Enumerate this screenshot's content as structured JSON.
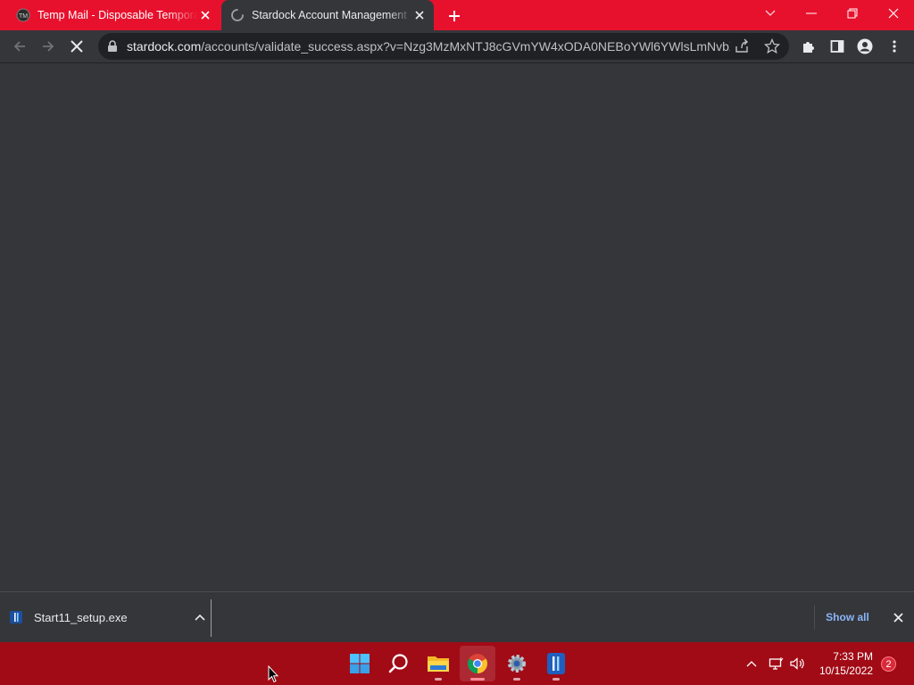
{
  "browser": {
    "tabs": [
      {
        "title": "Temp Mail - Disposable Temporary Email",
        "icon": "tempmail-favicon",
        "active": false
      },
      {
        "title": "Stardock Account Management - Validate",
        "icon": "loading-spinner-icon",
        "active": true
      }
    ],
    "url_host": "stardock.com",
    "url_path": "/accounts/validate_success.aspx?v=Nzg3MzMxNTJ8cGVmYW4xODA0NEBoYWl6YWlsLmNvbX...",
    "colors": {
      "accent": "#e8112d",
      "page_bg": "#35363a",
      "link": "#8ab4f8"
    }
  },
  "download_shelf": {
    "file_name": "Start11_setup.exe",
    "show_all_label": "Show all"
  },
  "taskbar": {
    "time": "7:33 PM",
    "date": "10/15/2022",
    "notification_count": "2",
    "apps": [
      "windows-start-icon",
      "search-icon",
      "file-explorer-icon",
      "chrome-icon",
      "settings-icon",
      "start11-icon"
    ]
  }
}
